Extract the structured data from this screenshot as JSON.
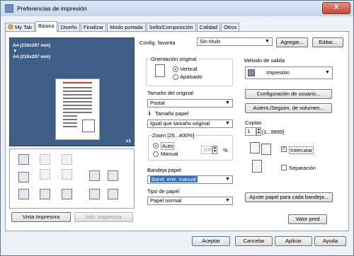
{
  "window": {
    "title": "Preferencias de impresión",
    "close": "X"
  },
  "tabs": [
    "My Tab",
    "Básico",
    "Diseño",
    "Finalizar",
    "Modo portada",
    "Sello/Composición",
    "Calidad",
    "Otros"
  ],
  "preview": {
    "line1": "A4 (210x297 mm)",
    "arrow": "▼",
    "line2": "A4 (210x297 mm)",
    "copies": "x1"
  },
  "left_buttons": {
    "printer_view": "Vista Impresora",
    "printer_info": "Info. impresora"
  },
  "favorite": {
    "label": "Config. favorita",
    "value": "Sin título",
    "add": "Agregar...",
    "edit": "Editar..."
  },
  "orientation": {
    "label": "Orientación original",
    "portrait": "Vertical",
    "landscape": "Apaisado"
  },
  "original_size": {
    "label": "Tamaño del original",
    "value": "Postal"
  },
  "paper_size": {
    "label": "Tamaño papel",
    "value": "Igual que tamaño original"
  },
  "zoom": {
    "label": "Zoom [25...400%]",
    "auto": "Auto",
    "manual": "Manual",
    "value": "100",
    "unit": "%"
  },
  "paper_tray": {
    "label": "Bandeja papel",
    "value": "Band. entr. manual"
  },
  "paper_type": {
    "label": "Tipo de papel",
    "value": "Papel normal"
  },
  "output": {
    "label": "Método de salida",
    "value": "Impresión"
  },
  "user_settings": "Configuración de usuario...",
  "auth": "Autent./Seguim. de volumen...",
  "copies": {
    "label": "Copias",
    "value": "1",
    "range": "[1...9999]"
  },
  "collate": "Intercalar",
  "offset": "Separación",
  "fit_paper": "Ajuste papel para cada bandeja...",
  "default_button": "Valor pred",
  "footer": {
    "ok": "Aceptar",
    "cancel": "Cancelar",
    "apply": "Aplicar",
    "help": "Ayuda"
  }
}
